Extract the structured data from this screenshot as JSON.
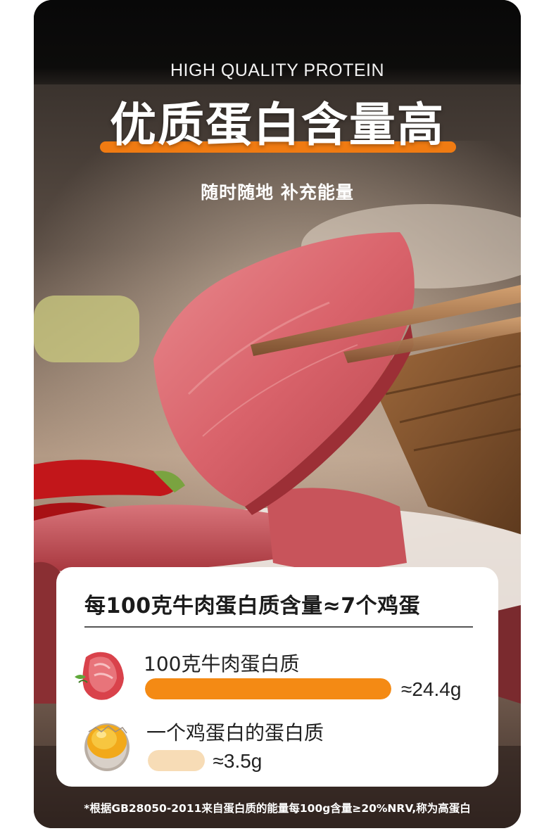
{
  "header": {
    "eyebrow": "HIGH QUALITY PROTEIN",
    "headline": "优质蛋白含量高",
    "subline": "随时随地 补充能量"
  },
  "comparison": {
    "title": "每100克牛肉蛋白质含量≈7个鸡蛋",
    "rows": [
      {
        "label": "100克牛肉蛋白质",
        "value": "≈24.4g",
        "icon": "beef-icon",
        "fraction": 1.0,
        "color": "#f48a14"
      },
      {
        "label": "一个鸡蛋白的蛋白质",
        "value": "≈3.5g",
        "icon": "egg-icon",
        "fraction": 0.23,
        "color": "#f7dcb6"
      }
    ]
  },
  "footnote": "*根据GB28050-2011来自蛋白质的能量每100g含量≥20%NRV,称为高蛋白",
  "colors": {
    "accent": "#f07b12",
    "card_bg": "#ffffff"
  }
}
